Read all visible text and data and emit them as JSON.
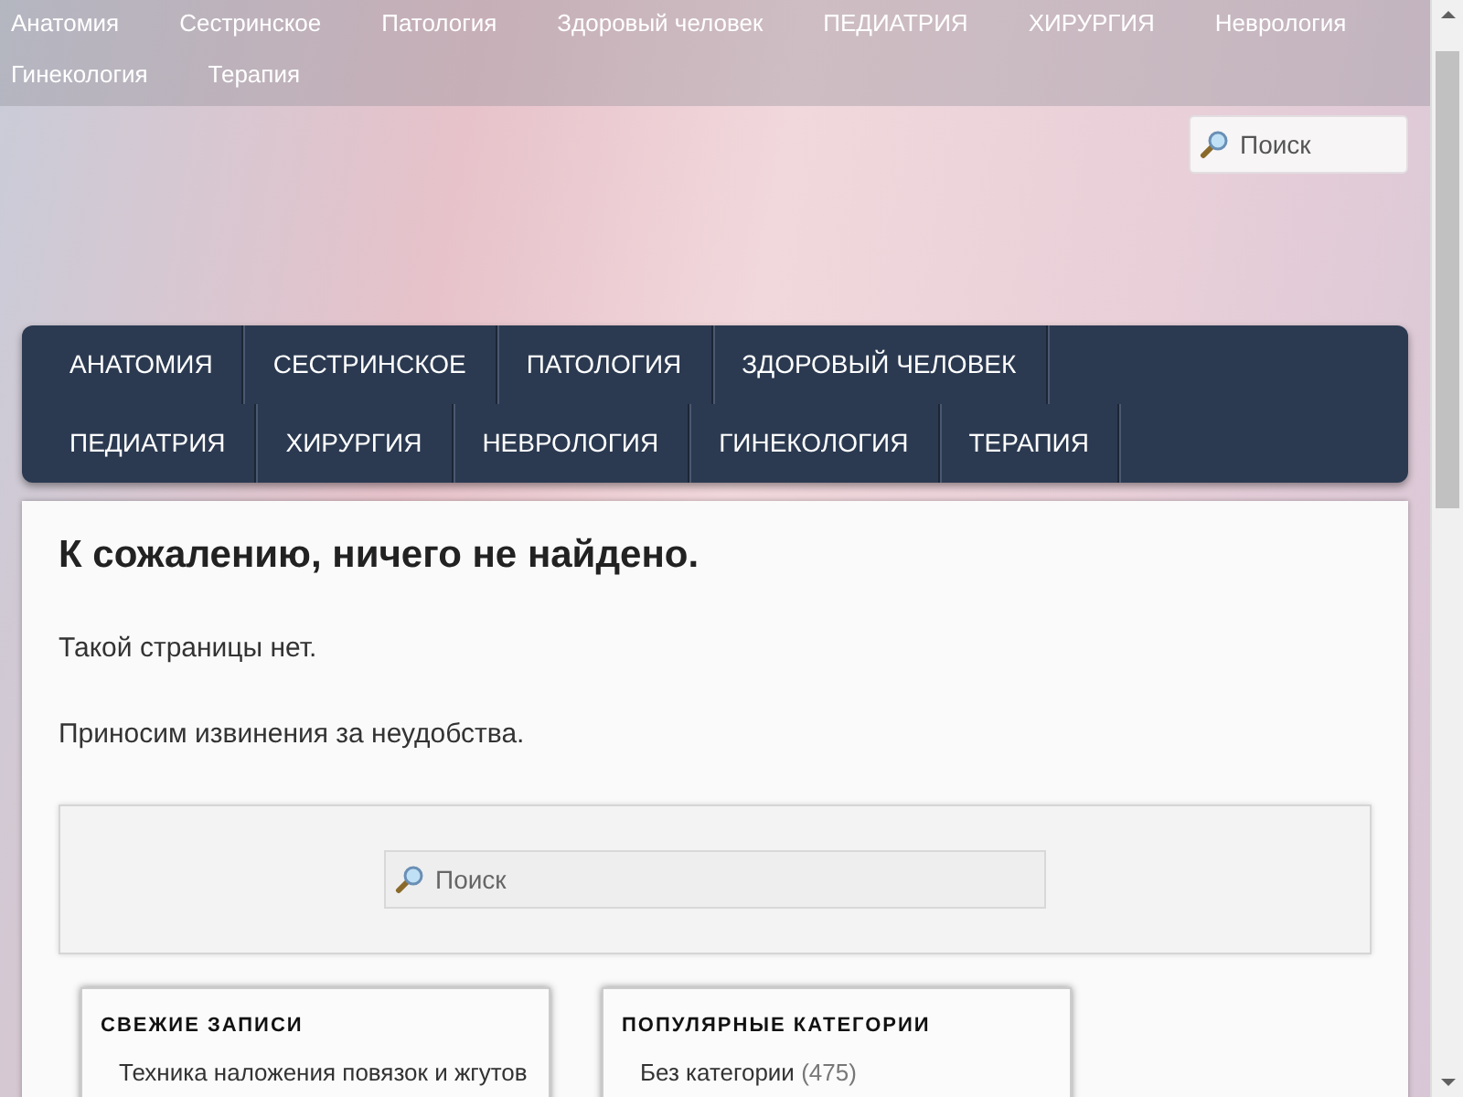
{
  "top_menu": [
    "Анатомия",
    "Сестринское",
    "Патология",
    "Здоровый человек",
    "ПЕДИАТРИЯ",
    "ХИРУРГИЯ",
    "Неврология",
    "Гинекология",
    "Терапия"
  ],
  "header_search": {
    "placeholder": "Поиск"
  },
  "main_menu": [
    "АНАТОМИЯ",
    "СЕСТРИНСКОЕ",
    "ПАТОЛОГИЯ",
    "ЗДОРОВЫЙ ЧЕЛОВЕК",
    "ПЕДИАТРИЯ",
    "ХИРУРГИЯ",
    "НЕВРОЛОГИЯ",
    "ГИНЕКОЛОГИЯ",
    "ТЕРАПИЯ"
  ],
  "content": {
    "title": "К сожалению, ничего не найдено.",
    "paragraphs": [
      "Такой страницы нет.",
      "Приносим извинения за неудобства."
    ],
    "search": {
      "placeholder": "Поиск"
    }
  },
  "widgets": [
    {
      "title": "СВЕЖИЕ ЗАПИСИ",
      "items": [
        {
          "text": "Техника наложения повязок и жгутов"
        }
      ]
    },
    {
      "title": "ПОПУЛЯРНЫЕ КАТЕГОРИИ",
      "items": [
        {
          "text": "Без категории",
          "count": "(475)"
        }
      ]
    }
  ]
}
